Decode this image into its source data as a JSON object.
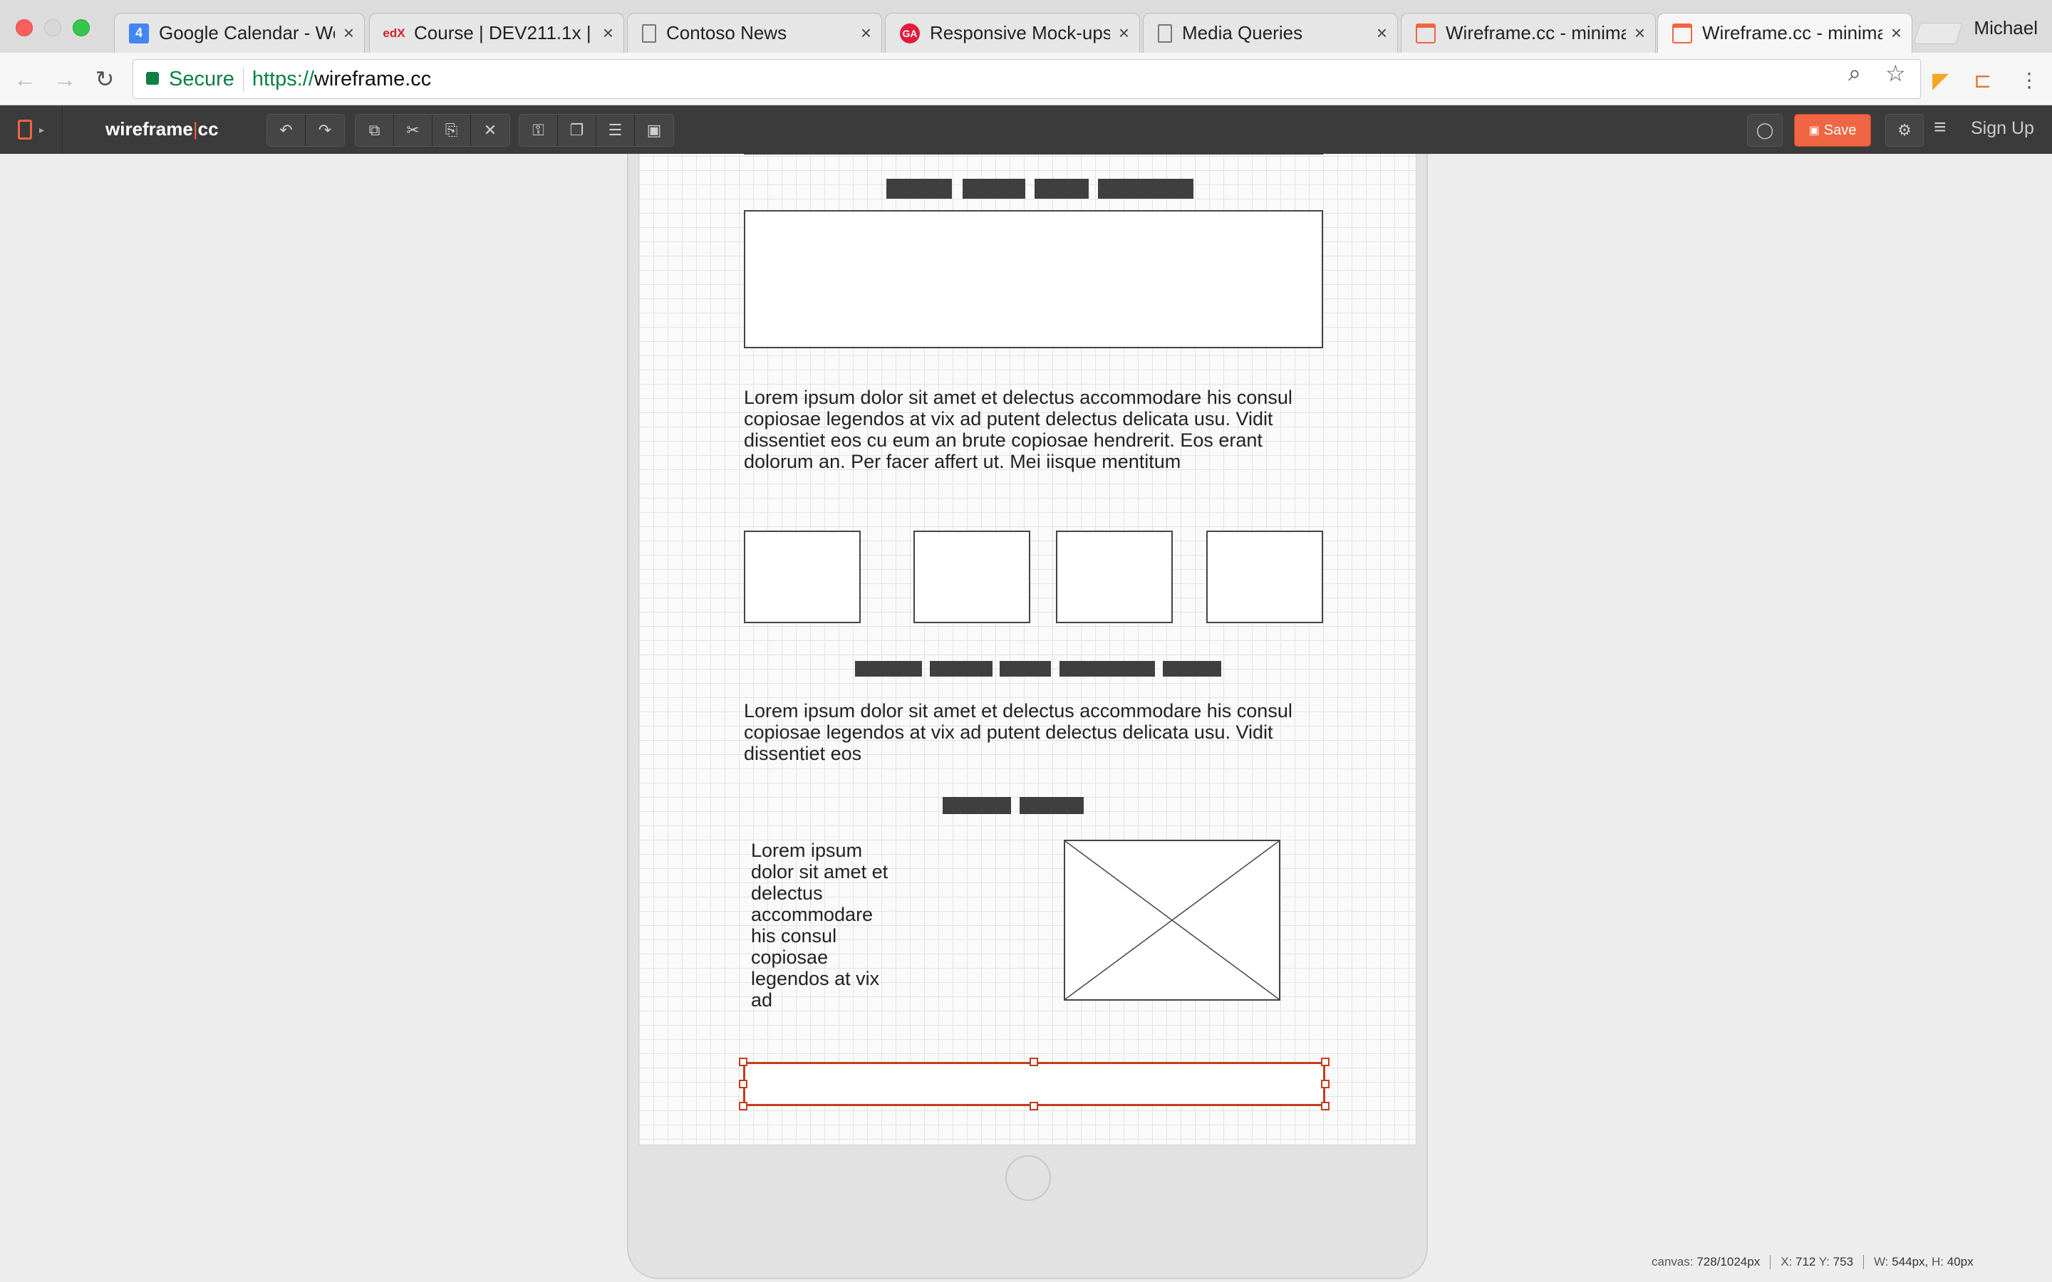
{
  "browser": {
    "tabs": [
      {
        "title": "Google Calendar - We",
        "favicon": "calendar-icon",
        "favicon_text": "4"
      },
      {
        "title": "Course | DEV211.1x |",
        "favicon": "edx-icon",
        "favicon_text": "edX"
      },
      {
        "title": "Contoso News",
        "favicon": "page-icon",
        "favicon_text": ""
      },
      {
        "title": "Responsive Mock-ups",
        "favicon": "ga-icon",
        "favicon_text": "GA"
      },
      {
        "title": "Media Queries",
        "favicon": "page-icon",
        "favicon_text": ""
      },
      {
        "title": "Wireframe.cc - minima",
        "favicon": "wireframe-icon",
        "favicon_text": ""
      },
      {
        "title": "Wireframe.cc - minima",
        "favicon": "wireframe-icon",
        "favicon_text": ""
      }
    ],
    "active_tab_index": 6,
    "profile": "Michael",
    "address": {
      "secure_label": "Secure",
      "scheme": "https://",
      "host": "wireframe.cc"
    }
  },
  "app": {
    "logo_left": "wireframe",
    "logo_sep": "|",
    "logo_right": "cc",
    "save_label": "Save",
    "signup_label": "Sign Up",
    "accent": "#f06543"
  },
  "canvas": {
    "para1": "Lorem ipsum dolor sit amet et delectus accommodare his consul copiosae legendos at vix ad putent delectus delicata usu. Vidit dissentiet eos cu eum an brute copiosae hendrerit. Eos erant dolorum an. Per facer affert ut. Mei iisque mentitum",
    "para2": "Lorem ipsum dolor sit amet et delectus accommodare his consul copiosae legendos at vix ad putent delectus delicata usu. Vidit dissentiet eos",
    "para3": "Lorem ipsum dolor sit amet et delectus accommodare his consul copiosae legendos at vix ad"
  },
  "status": {
    "canvas_label": "canvas:",
    "canvas_value": "728/1024px",
    "x_label": "X:",
    "x_value": "712",
    "y_label": "Y:",
    "y_value": "753",
    "w_label": "W:",
    "w_value": "544px,",
    "h_label": "H:",
    "h_value": "40px"
  }
}
